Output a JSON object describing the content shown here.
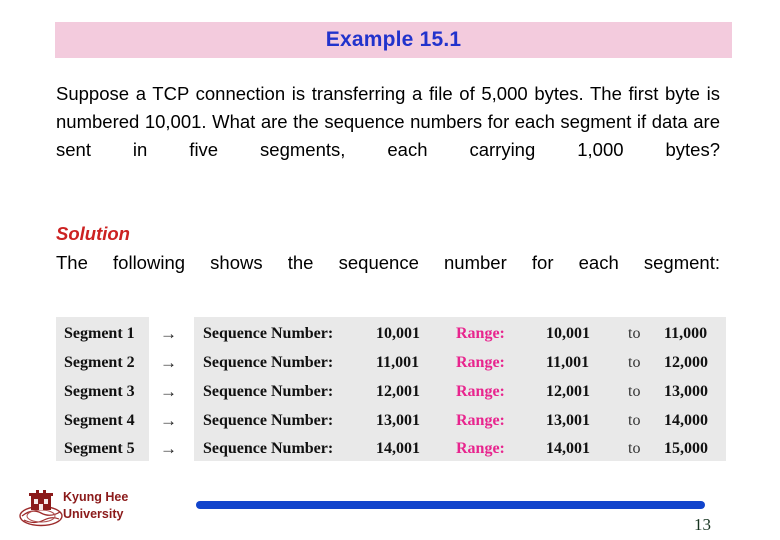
{
  "slide": {
    "title": "Example 15.1",
    "title_bg_color": "#f3cbdd",
    "title_text_color": "#2233cc"
  },
  "body": {
    "question": "Suppose a TCP connection is transferring a file of 5,000 bytes. The first byte is numbered 10,001. What are the sequence numbers for each segment if data are sent in five segments, each carrying 1,000 bytes?"
  },
  "solution": {
    "heading": "Solution",
    "heading_color": "#cc2222",
    "intro": "The following shows the sequence number for each segment:"
  },
  "table": {
    "arrow_glyph": "→",
    "to_word": "to",
    "range_label": "Range:",
    "sequence_label": "Sequence Number:",
    "range_color": "#e8258e",
    "panel_bg_color": "#e9e9e9",
    "rows": [
      {
        "segment": "Segment 1",
        "arrow": "→",
        "label": "Sequence Number:",
        "number": "10,001",
        "range_label": "Range:",
        "range_start": "10,001",
        "to": "to",
        "range_end": "11,000"
      },
      {
        "segment": "Segment 2",
        "arrow": "→",
        "label": "Sequence Number:",
        "number": "11,001",
        "range_label": "Range:",
        "range_start": "11,001",
        "to": "to",
        "range_end": "12,000"
      },
      {
        "segment": "Segment 3",
        "arrow": "→",
        "label": "Sequence Number:",
        "number": "12,001",
        "range_label": "Range:",
        "range_start": "12,001",
        "to": "to",
        "range_end": "13,000"
      },
      {
        "segment": "Segment 4",
        "arrow": "→",
        "label": "Sequence Number:",
        "number": "13,001",
        "range_label": "Range:",
        "range_start": "13,001",
        "to": "to",
        "range_end": "14,000"
      },
      {
        "segment": "Segment 5",
        "arrow": "→",
        "label": "Sequence Number:",
        "number": "14,001",
        "range_label": "Range:",
        "range_start": "14,001",
        "to": "to",
        "range_end": "15,000"
      }
    ]
  },
  "footer": {
    "university_line1": "Kyung Hee",
    "university_line2": "University",
    "university_color": "#8b1a1a",
    "bar_color": "#1144cc",
    "page_number": "13"
  }
}
